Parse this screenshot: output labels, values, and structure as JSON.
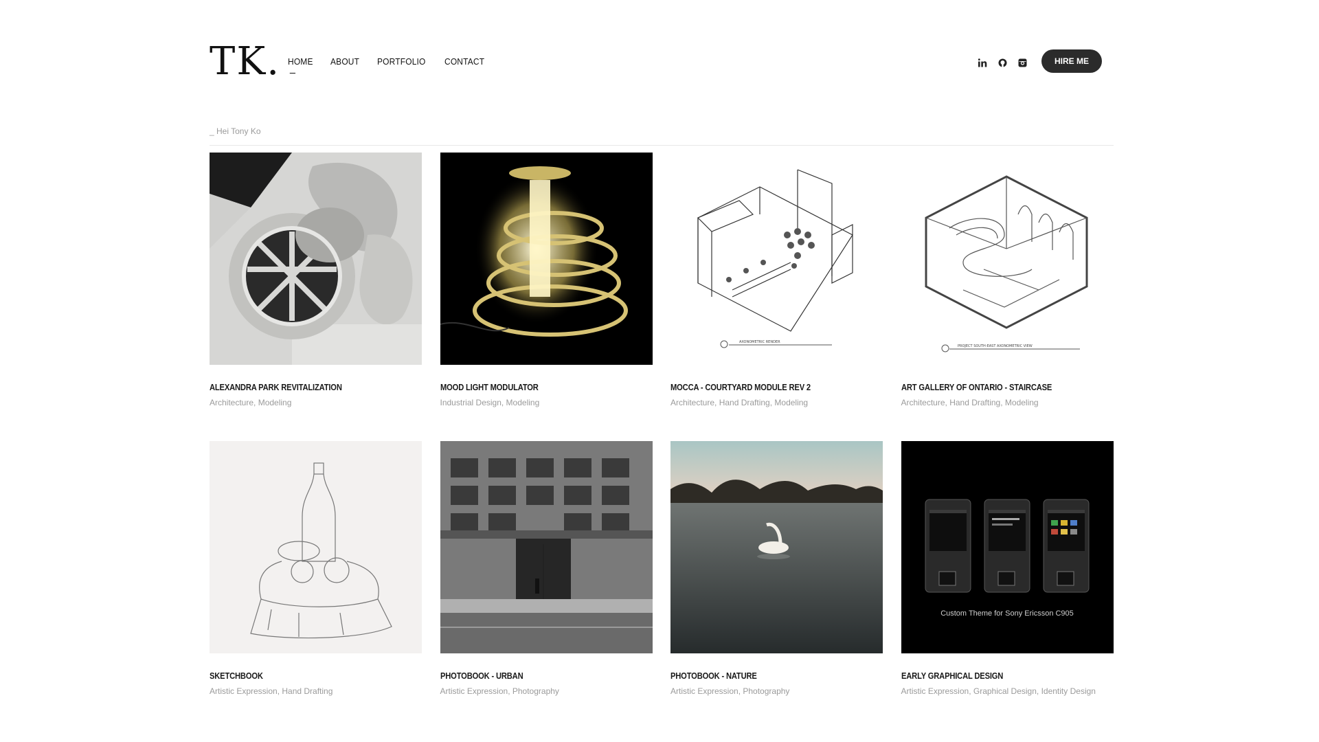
{
  "header": {
    "logo": "TK.",
    "nav": [
      {
        "label": "HOME",
        "active": true
      },
      {
        "label": "ABOUT",
        "active": false
      },
      {
        "label": "PORTFOLIO",
        "active": false
      },
      {
        "label": "CONTACT",
        "active": false
      }
    ],
    "socials": [
      "linkedin-icon",
      "github-icon",
      "instagram-icon"
    ],
    "hire_label": "HIRE ME"
  },
  "subtitle": "_ Hei Tony Ko",
  "projects": [
    {
      "title": "ALEXANDRA PARK REVITALIZATION",
      "tags": "Architecture, Modeling"
    },
    {
      "title": "MOOD LIGHT MODULATOR",
      "tags": "Industrial Design, Modeling"
    },
    {
      "title": "MOCCA - COURTYARD MODULE REV 2",
      "tags": "Architecture, Hand Drafting, Modeling"
    },
    {
      "title": "ART GALLERY OF ONTARIO - STAIRCASE",
      "tags": "Architecture, Hand Drafting, Modeling"
    },
    {
      "title": "SKETCHBOOK",
      "tags": "Artistic Expression, Hand Drafting"
    },
    {
      "title": "PHOTOBOOK - URBAN",
      "tags": "Artistic Expression, Photography"
    },
    {
      "title": "PHOTOBOOK - NATURE",
      "tags": "Artistic Expression, Photography"
    },
    {
      "title": "EARLY GRAPHICAL DESIGN",
      "tags": "Artistic Expression, Graphical Design, Identity Design"
    }
  ],
  "image_text": {
    "axo_render": "AXONOMETRIC RENDER",
    "axo_view": "PROJECT SOUTH-EAST AXONOMETRIC VIEW",
    "phone_caption": "Custom Theme for Sony Ericsson C905"
  },
  "colors": {
    "text": "#1a1a1a",
    "muted": "#9a9a9a",
    "button_bg": "#2b2b2b"
  }
}
